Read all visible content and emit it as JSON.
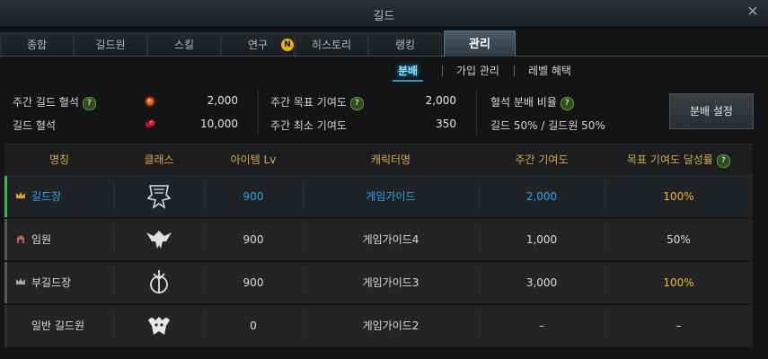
{
  "window": {
    "title": "길드"
  },
  "tabs": [
    {
      "label": "종합"
    },
    {
      "label": "길드원"
    },
    {
      "label": "스킬"
    },
    {
      "label": "연구",
      "badge": "N"
    },
    {
      "label": "히스토리"
    },
    {
      "label": "랭킹"
    },
    {
      "label": "관리",
      "active": true
    }
  ],
  "subtabs": [
    {
      "label": "분배",
      "active": true
    },
    {
      "label": "가입 관리"
    },
    {
      "label": "레벨 혜택"
    }
  ],
  "info": {
    "weekly_bloodstone_label": "주간 길드 혈석",
    "weekly_bloodstone_value": "2,000",
    "bloodstone_label": "길드 혈석",
    "bloodstone_value": "10,000",
    "weekly_target_label": "주간 목표 기여도",
    "weekly_target_value": "2,000",
    "weekly_min_label": "주간 최소 기여도",
    "weekly_min_value": "350",
    "ratio_label": "혈석 분배 비율",
    "ratio_value": "길드 50% / 길드원 50%",
    "distribute_button": "분배 설정"
  },
  "table": {
    "headers": [
      "명칭",
      "클래스",
      "아이템 Lv",
      "캐릭터명",
      "주간 기여도",
      "목표 기여도 달성률"
    ],
    "rows": [
      {
        "rank": "길드장",
        "rank_icon": "crown-icon",
        "class_icon": "class-emblem-1",
        "item_lv": "900",
        "character": "게임가이드",
        "weekly": "2,000",
        "rate": "100%",
        "selected": true
      },
      {
        "rank": "임원",
        "rank_icon": "helmet-icon",
        "class_icon": "class-emblem-2",
        "item_lv": "900",
        "character": "게임가이드4",
        "weekly": "1,000",
        "rate": "50%"
      },
      {
        "rank": "부길드장",
        "rank_icon": "crown-silver-icon",
        "class_icon": "class-emblem-3",
        "item_lv": "900",
        "character": "게임가이드3",
        "weekly": "3,000",
        "rate": "100%"
      },
      {
        "rank": "일반 길드원",
        "rank_icon": "",
        "class_icon": "class-emblem-4",
        "item_lv": "0",
        "character": "게임가이드2",
        "weekly": "–",
        "rate": "–"
      }
    ]
  },
  "colors": {
    "accent_blue": "#2fa3ea",
    "gold": "#f0b91e",
    "header_gold": "#d8a94a",
    "selected_bar": "#38b84a"
  }
}
